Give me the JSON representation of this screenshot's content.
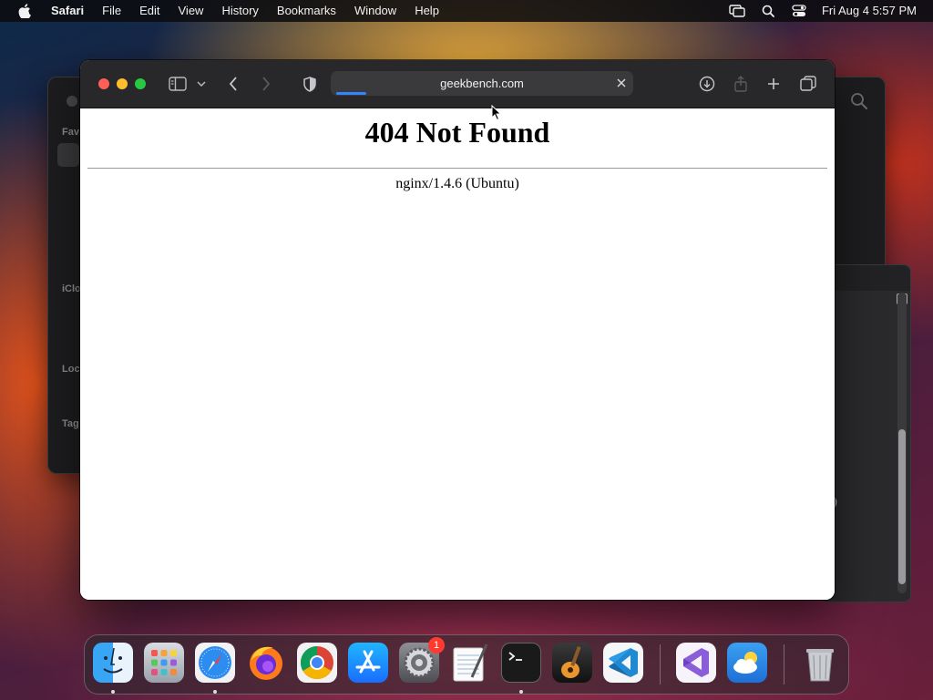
{
  "menubar": {
    "app_name": "Safari",
    "items": [
      "File",
      "Edit",
      "View",
      "History",
      "Bookmarks",
      "Window",
      "Help"
    ],
    "clock": "Fri Aug 4  5:57 PM",
    "status_icons": [
      "screen-mirroring-icon",
      "spotlight-search-icon",
      "control-center-icon"
    ]
  },
  "finder": {
    "sidebar_labels": [
      "Fav",
      "iClo",
      "Loc",
      "Tag"
    ]
  },
  "side_window": {
    "text_fragment": ")"
  },
  "safari": {
    "address": "geekbench.com",
    "page": {
      "heading": "404 Not Found",
      "server": "nginx/1.4.6 (Ubuntu)"
    }
  },
  "dock": {
    "apps": [
      {
        "name": "Finder",
        "running": true
      },
      {
        "name": "Launchpad",
        "running": false
      },
      {
        "name": "Safari",
        "running": true
      },
      {
        "name": "Firefox",
        "running": false
      },
      {
        "name": "Google Chrome",
        "running": false
      },
      {
        "name": "App Store",
        "running": false
      },
      {
        "name": "System Settings",
        "running": false,
        "badge": "1"
      },
      {
        "name": "TextEdit",
        "running": false
      },
      {
        "name": "Terminal",
        "running": true
      },
      {
        "name": "GarageBand",
        "running": false
      },
      {
        "name": "Visual Studio Code",
        "running": false
      },
      {
        "name": "Visual Studio",
        "running": false
      },
      {
        "name": "Weather",
        "running": false
      },
      {
        "name": "Trash",
        "running": false
      }
    ]
  },
  "colors": {
    "close": "#ff5f57",
    "minimize": "#febc2e",
    "maximize": "#28c840",
    "progress": "#2f86ff",
    "badge": "#ff3b30"
  }
}
